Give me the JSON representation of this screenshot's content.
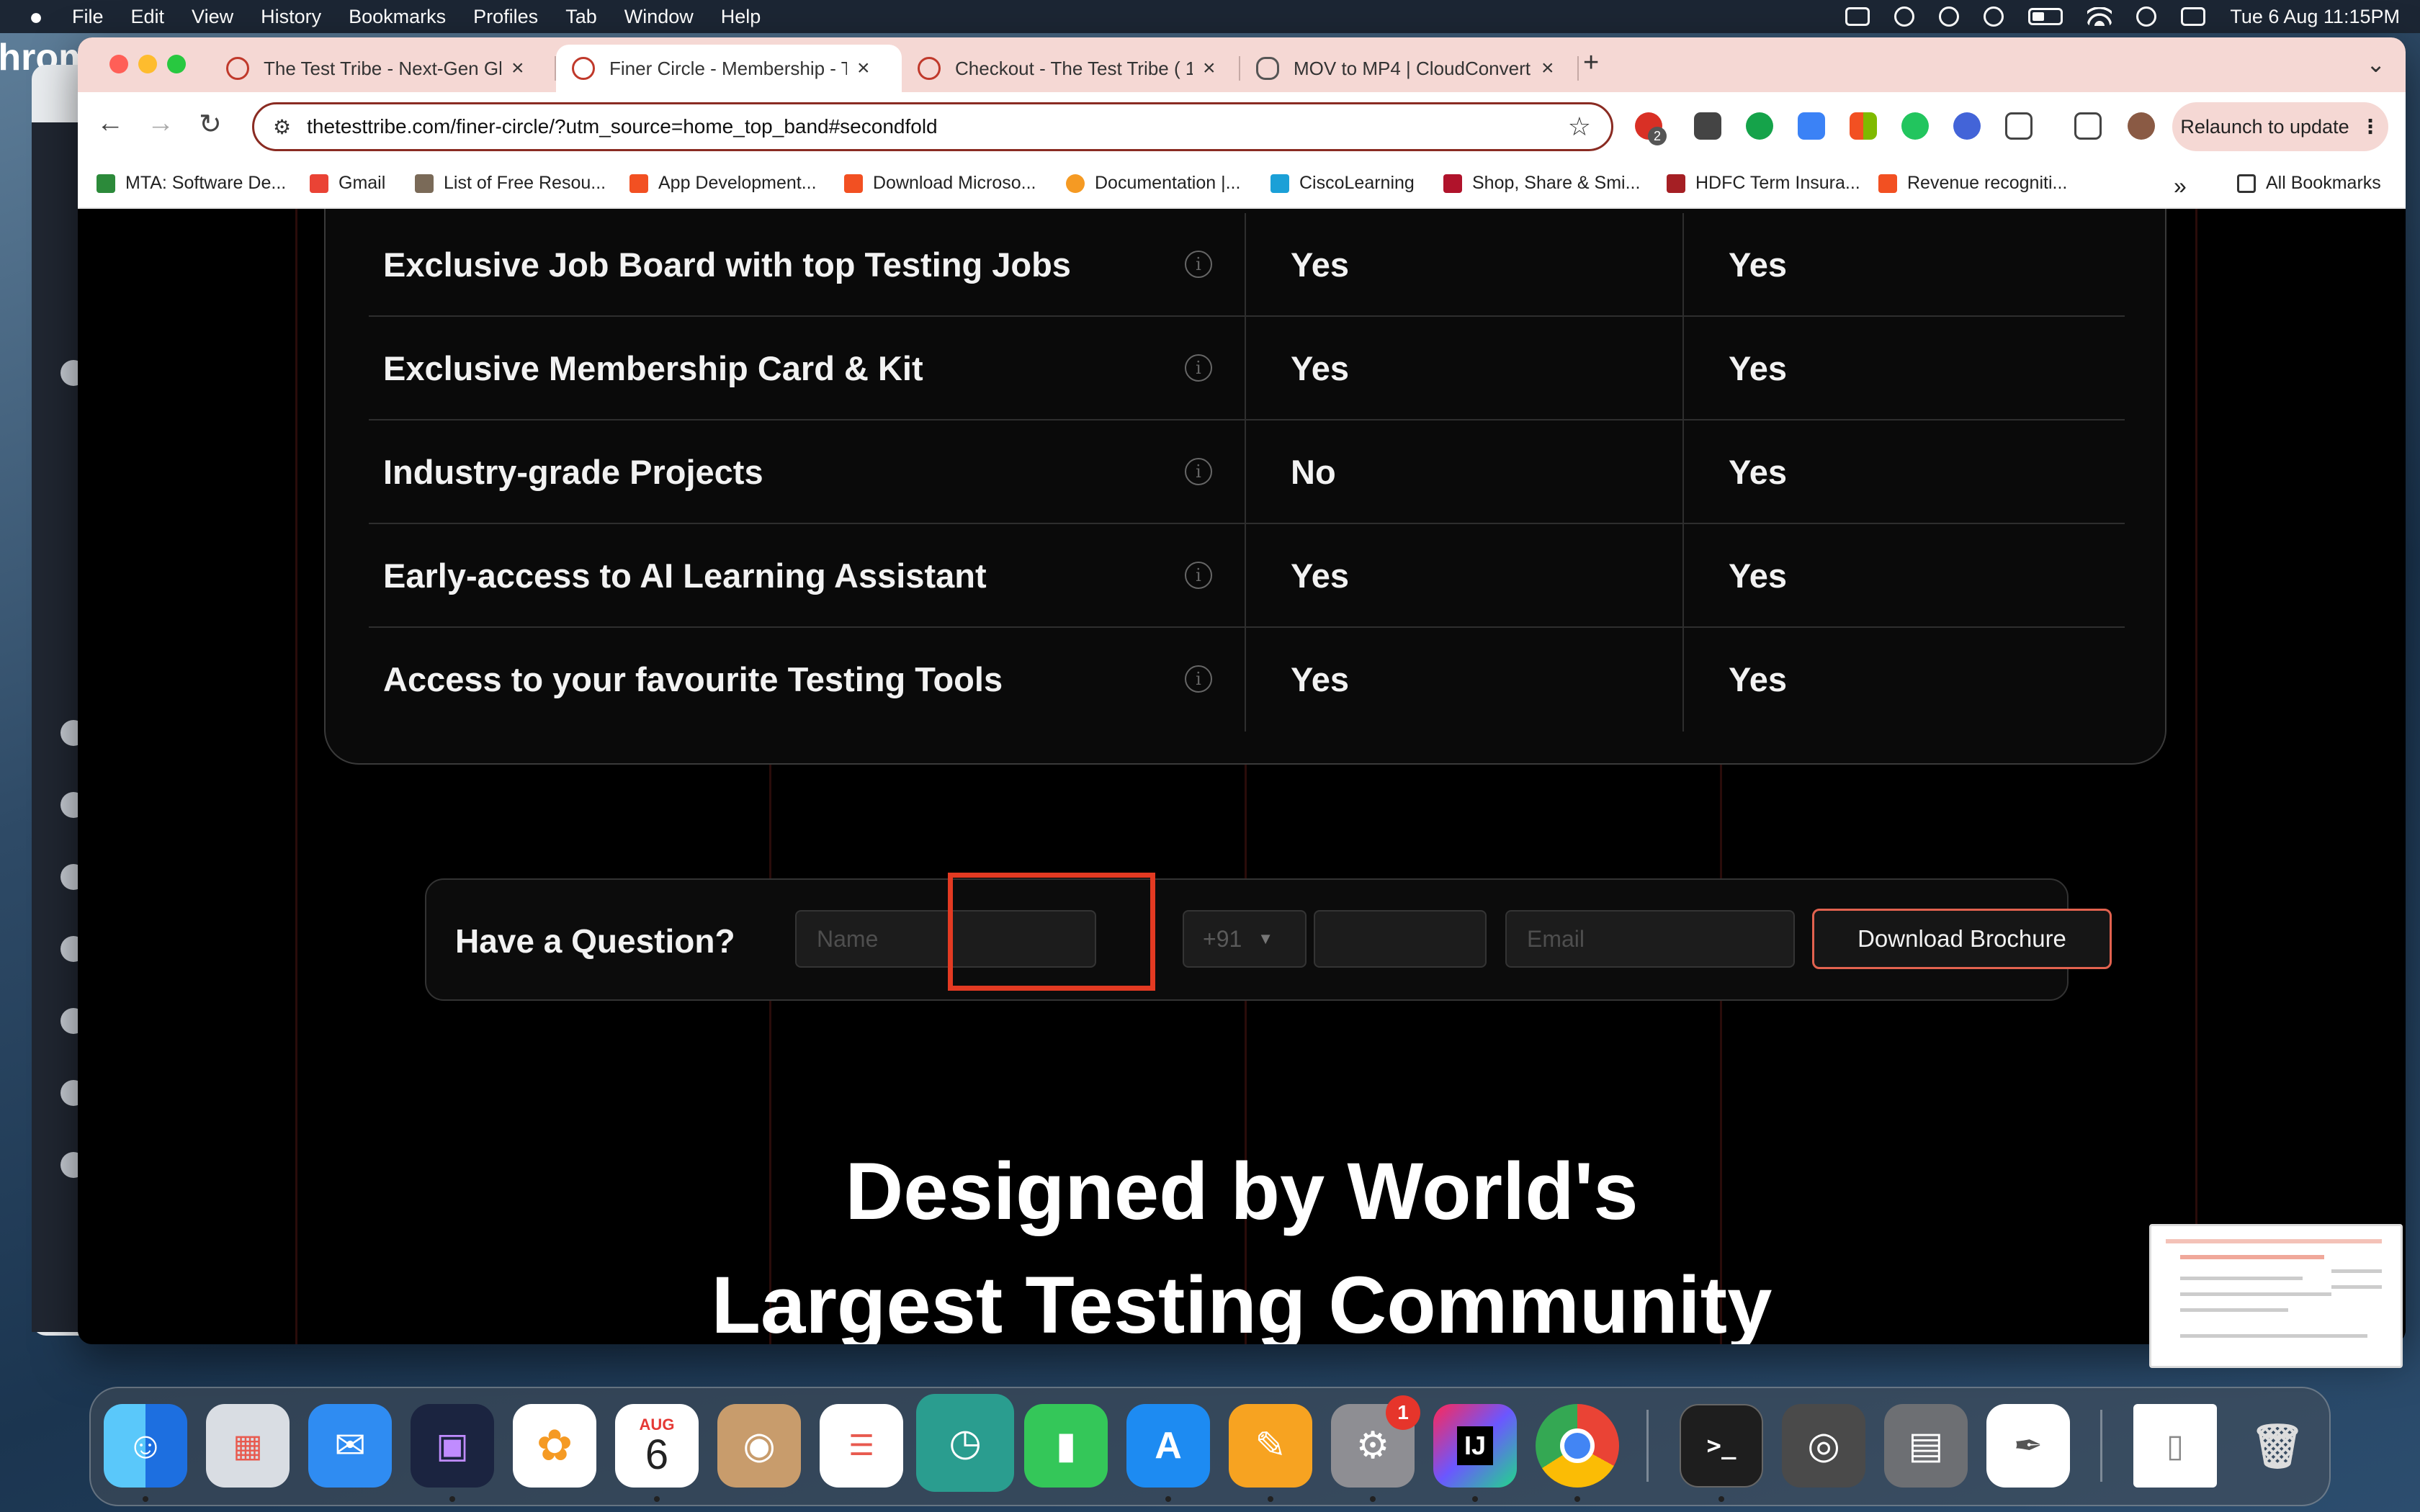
{
  "menubar": {
    "apple": "",
    "app_name": "Chrome",
    "items": [
      "File",
      "Edit",
      "View",
      "History",
      "Bookmarks",
      "Profiles",
      "Tab",
      "Window",
      "Help"
    ],
    "clock": "Tue 6 Aug  11:15PM"
  },
  "browser": {
    "tabs": [
      {
        "title": "The Test Tribe - Next-Gen Glo",
        "close": "×"
      },
      {
        "title": "Finer Circle - Membership - T",
        "close": "×"
      },
      {
        "title": "Checkout - The Test Tribe ( 1",
        "close": "×"
      },
      {
        "title": "MOV to MP4 | CloudConvert",
        "close": "×"
      }
    ],
    "new_tab": "+",
    "url": "thetesttribe.com/finer-circle/?utm_source=home_top_band#secondfold",
    "ext_badge": "2",
    "relaunch_label": "Relaunch to update",
    "bookmarks": [
      {
        "label": "MTA: Software De...",
        "color": "#2c8a3a"
      },
      {
        "label": "Gmail",
        "color": "#ea4335"
      },
      {
        "label": "List of Free Resou...",
        "color": "#7a6a58"
      },
      {
        "label": "App Development...",
        "color": "#f25022"
      },
      {
        "label": "Download Microso...",
        "color": "#f25022"
      },
      {
        "label": "Documentation  |...",
        "color": "#f59a23"
      },
      {
        "label": "CiscoLearning",
        "color": "#1ba0d7"
      },
      {
        "label": "Shop, Share & Smi...",
        "color": "#b0132b"
      },
      {
        "label": "HDFC Term Insura...",
        "color": "#a51f24"
      },
      {
        "label": "Revenue recogniti...",
        "color": "#f25022"
      }
    ],
    "bookmarks_more": "»",
    "all_bookmarks": "All Bookmarks"
  },
  "table": {
    "info_glyph": "i",
    "rows": [
      {
        "feature": "Exclusive Job Board with top Testing Jobs",
        "col1": "Yes",
        "col2": "Yes"
      },
      {
        "feature": "Exclusive Membership Card & Kit",
        "col1": "Yes",
        "col2": "Yes"
      },
      {
        "feature": "Industry-grade Projects",
        "col1": "No",
        "col2": "Yes"
      },
      {
        "feature": "Early-access to AI Learning Assistant",
        "col1": "Yes",
        "col2": "Yes"
      },
      {
        "feature": "Access to your favourite Testing Tools",
        "col1": "Yes",
        "col2": "Yes"
      }
    ]
  },
  "question_form": {
    "title": "Have a Question?",
    "name_placeholder": "Name",
    "country_code": "+91",
    "phone_value": "",
    "email_placeholder": "Email",
    "download_label": "Download Brochure",
    "highlight_color": "#e33a22"
  },
  "headline": {
    "line1": "Designed by World's",
    "line2": "Largest Testing Community"
  },
  "dock": {
    "calendar_month": "AUG",
    "calendar_day": "6",
    "settings_badge": "1",
    "intellij": "IJ",
    "terminal": ">_"
  }
}
